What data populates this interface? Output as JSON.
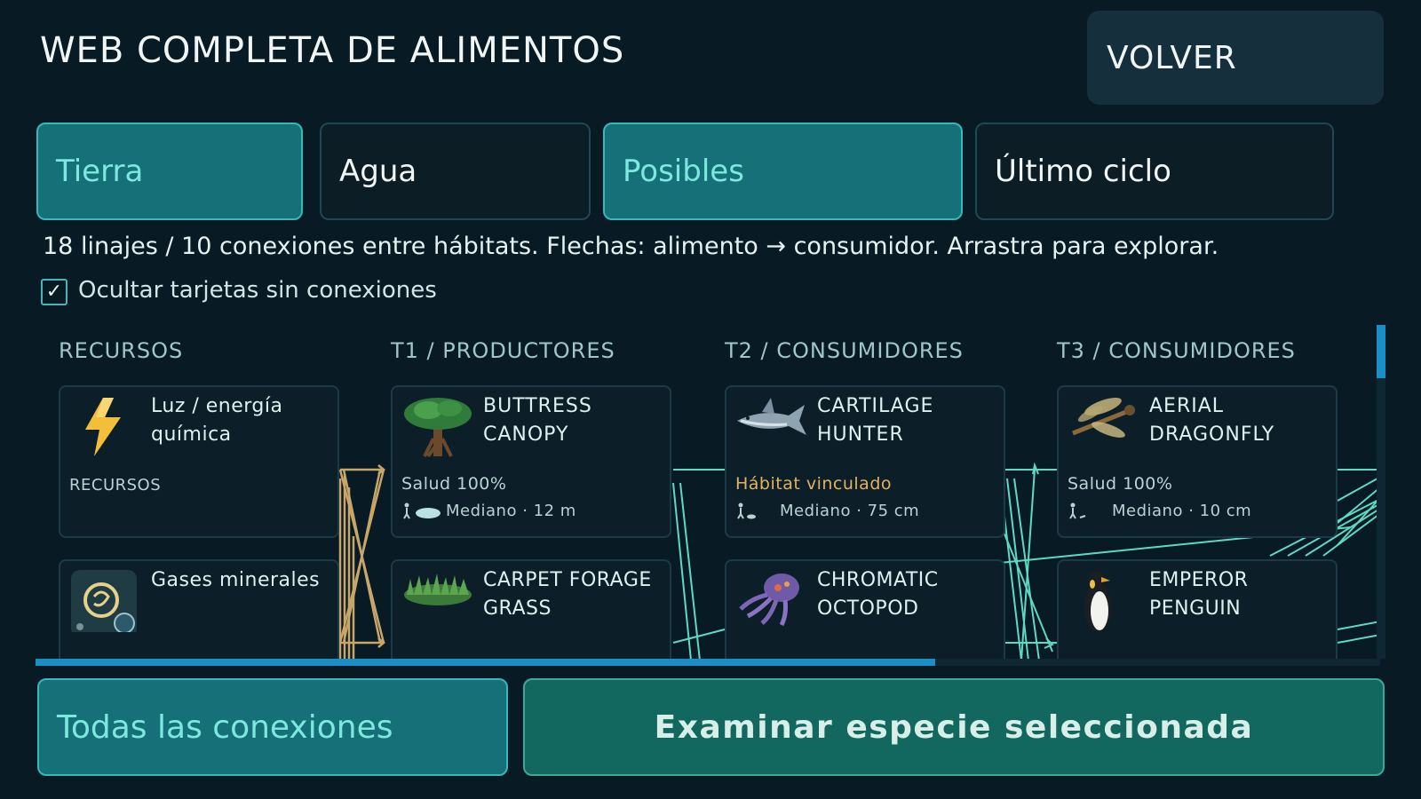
{
  "header": {
    "title": "WEB COMPLETA DE ALIMENTOS",
    "back_label": "VOLVER"
  },
  "tabs": [
    {
      "label": "Tierra",
      "active": true
    },
    {
      "label": "Agua",
      "active": false
    },
    {
      "label": "Posibles",
      "active": true
    },
    {
      "label": "Último ciclo",
      "active": false
    }
  ],
  "info_text": "18 linajes / 10 conexiones entre hábitats. Flechas: alimento → consumidor. Arrastra para explorar.",
  "filter": {
    "checked": true,
    "check_glyph": "✓",
    "label": "Ocultar tarjetas sin conexiones"
  },
  "columns": [
    {
      "title": "RECURSOS"
    },
    {
      "title": "T1 / PRODUCTORES"
    },
    {
      "title": "T2 / CONSUMIDORES"
    },
    {
      "title": "T3 / CONSUMIDORES"
    }
  ],
  "cards": {
    "light": {
      "name": "Luz / energía química",
      "category": "RECURSOS",
      "icon": "lightning-icon"
    },
    "gases": {
      "name": "Gases minerales",
      "icon": "mineral-gas-icon"
    },
    "buttress": {
      "name": "BUTTRESS CANOPY",
      "status": "Salud 100%",
      "size": "Mediano · 12 m",
      "icon": "tree-icon"
    },
    "carpet": {
      "name": "CARPET FORAGE GRASS",
      "icon": "grass-icon"
    },
    "cartilage": {
      "name": "CARTILAGE HUNTER",
      "status": "Hábitat vinculado",
      "size": "Mediano · 75 cm",
      "icon": "shark-icon",
      "status_color": "#e3b25e"
    },
    "octopod": {
      "name": "CHROMATIC OCTOPOD",
      "icon": "octopus-icon"
    },
    "dragonfly": {
      "name": "AERIAL DRAGONFLY",
      "status": "Salud 100%",
      "size": "Mediano · 10 cm",
      "icon": "dragonfly-icon"
    },
    "penguin": {
      "name": "EMPEROR PENGUIN",
      "icon": "penguin-icon"
    }
  },
  "footer": {
    "all_connections_label": "Todas las conexiones",
    "examine_label": "Examinar especie seleccionada"
  },
  "colors": {
    "accent": "#38b8b8",
    "active_tab": "#167078",
    "edge_resource": "#c8a66a",
    "edge_species": "#5ed9c4",
    "scroll": "#1a8fc5",
    "warning": "#e3b25e"
  }
}
